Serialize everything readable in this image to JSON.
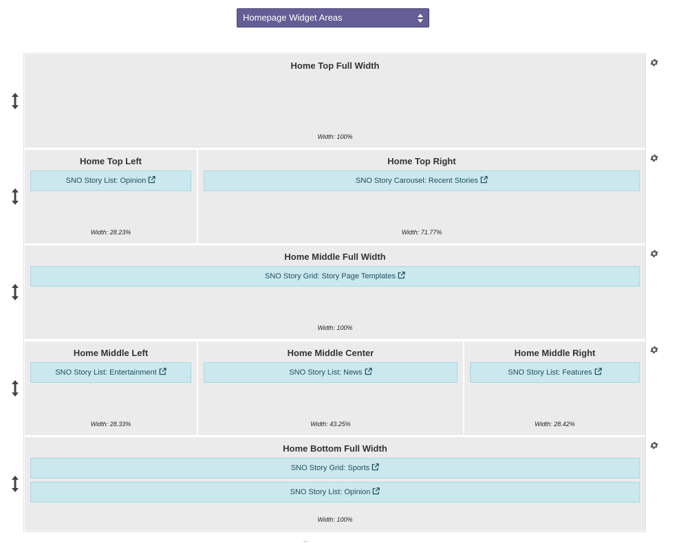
{
  "selector": {
    "value": "Homepage Widget Areas"
  },
  "rows": [
    {
      "areas": [
        {
          "title": "Home Top Full Width",
          "width": "Width: 100%",
          "widgets": []
        }
      ]
    },
    {
      "areas": [
        {
          "title": "Home Top Left",
          "width": "Width: 28.23%",
          "widgets": [
            "SNO Story List: Opinion"
          ]
        },
        {
          "title": "Home Top Right",
          "width": "Width: 71.77%",
          "widgets": [
            "SNO Story Carousel: Recent Stories"
          ]
        }
      ]
    },
    {
      "areas": [
        {
          "title": "Home Middle Full Width",
          "width": "Width: 100%",
          "widgets": [
            "SNO Story Grid: Story Page Templates"
          ]
        }
      ]
    },
    {
      "areas": [
        {
          "title": "Home Middle Left",
          "width": "Width: 28.33%",
          "widgets": [
            "SNO Story List: Entertainment"
          ]
        },
        {
          "title": "Home Middle Center",
          "width": "Width: 43.25%",
          "widgets": [
            "SNO Story List: News"
          ]
        },
        {
          "title": "Home Middle Right",
          "width": "Width: 28.42%",
          "widgets": [
            "SNO Story List: Features"
          ]
        }
      ]
    },
    {
      "areas": [
        {
          "title": "Home Bottom Full Width",
          "width": "Width: 100%",
          "widgets": [
            "SNO Story Grid: Sports",
            "SNO Story List: Opinion"
          ]
        }
      ]
    }
  ],
  "icons": {
    "row_handle": "vertical-resize-arrow-icon",
    "row_settings": "gear-icon",
    "widget_link": "external-link-icon",
    "select_arrows": "select-up-down-arrows-icon"
  }
}
